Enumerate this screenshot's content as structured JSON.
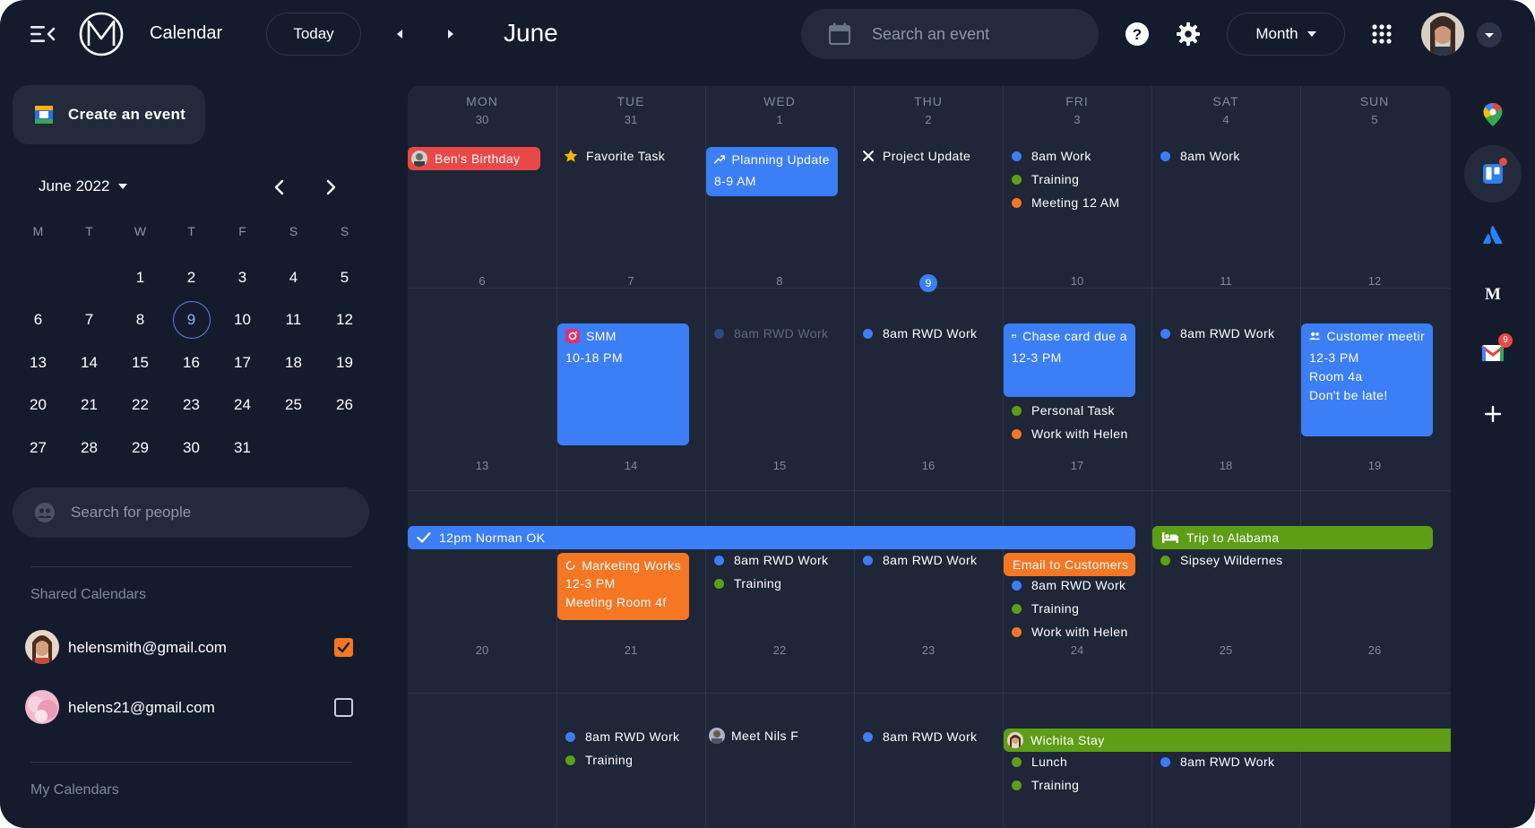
{
  "app": {
    "title": "Calendar"
  },
  "toolbar": {
    "today_label": "Today",
    "month_title": "June",
    "search_placeholder": "Search an event",
    "view_label": "Month"
  },
  "sidebar": {
    "create_label": "Create an event",
    "mini_month_label": "June 2022",
    "weekday_initials": [
      "M",
      "T",
      "W",
      "T",
      "F",
      "S",
      "S"
    ],
    "selected_day": "9",
    "people_search_placeholder": "Search for people",
    "shared_heading": "Shared Calendars",
    "shared": [
      {
        "email": "helensmith@gmail.com",
        "checked": true
      },
      {
        "email": "helens21@gmail.com",
        "checked": false
      }
    ],
    "my_heading": "My Calendars"
  },
  "grid": {
    "weekdays": [
      "MON",
      "TUE",
      "WED",
      "THU",
      "FRI",
      "SAT",
      "SUN"
    ],
    "weeks": [
      [
        "30",
        "31",
        "1",
        "2",
        "3",
        "4",
        "5"
      ],
      [
        "6",
        "7",
        "8",
        "9",
        "10",
        "11",
        "12"
      ],
      [
        "13",
        "14",
        "15",
        "16",
        "17",
        "18",
        "19"
      ],
      [
        "20",
        "21",
        "22",
        "23",
        "24",
        "25",
        "26"
      ]
    ],
    "today": "9"
  },
  "events": {
    "bens_birthday": "Ben's Birthday",
    "favorite_task": "Favorite Task",
    "planning_update": "Planning Update",
    "planning_time": "8-9 AM",
    "project_update": "Project Update",
    "w1_fri_1": "8am Work",
    "w1_fri_2": "Training",
    "w1_fri_3": "Meeting 12 AM",
    "w1_sat_1": "8am Work",
    "smm": "SMM",
    "smm_time": "10-18 PM",
    "w2_wed_1": "8am RWD Work",
    "w2_thu_1": "8am RWD Work",
    "chase": "Chase card due a",
    "chase_time": "12-3 PM",
    "w2_fri_2": "Personal Task",
    "w2_fri_3": "Work with Helen",
    "w2_sat_1": "8am RWD Work",
    "customer": "Customer meetir",
    "customer_time": "12-3 PM",
    "customer_room": "Room 4a",
    "customer_note": "Don't be late!",
    "norman": "12pm Norman OK",
    "trip": "Trip to Alabama",
    "marketing": "Marketing Works",
    "marketing_time": "12-3 PM",
    "marketing_room": "Meeting Room 4f",
    "w3_wed_1": "8am RWD Work",
    "w3_wed_2": "Training",
    "w3_thu_1": "8am RWD Work",
    "email_customers": "Email to Customers",
    "w3_fri_2": "8am RWD Work",
    "w3_fri_3": "Training",
    "w3_fri_4": "Work with Helen",
    "w3_sat_1": "Sipsey Wildernes",
    "w4_tue_1": "8am RWD Work",
    "w4_tue_2": "Training",
    "w4_wed_1": "Meet Nils F",
    "w4_thu_1": "8am RWD Work",
    "wichita": "Wichita Stay",
    "w4_fri_2": "Lunch",
    "w4_fri_3": "Training",
    "w4_sat_1": "8am RWD Work"
  },
  "rail": {
    "gmail_badge": "9"
  },
  "colors": {
    "background": "#141b2d",
    "grid": "#1e2638",
    "accent_blue": "#3b7ef6",
    "orange": "#f57623",
    "green": "#5d9e16",
    "red": "#e94848"
  },
  "icons": [
    "menu-collapse-icon",
    "app-logo-icon",
    "chevron-left-icon",
    "chevron-right-icon",
    "calendar-icon",
    "help-icon",
    "gear-icon",
    "apps-grid-icon",
    "caret-down-icon",
    "maps-icon",
    "trello-icon",
    "atlassian-icon",
    "medium-icon",
    "gmail-icon",
    "plus-icon"
  ]
}
